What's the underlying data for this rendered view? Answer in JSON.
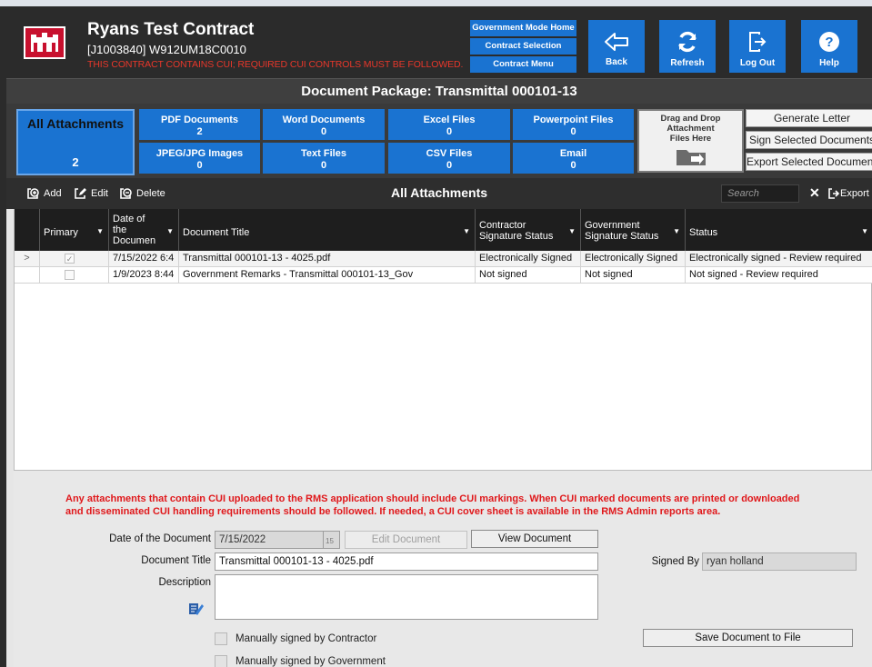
{
  "header": {
    "title": "Ryans Test Contract",
    "contract_id": "[J1003840] W912UM18C0010",
    "cui_warning": "THIS CONTRACT CONTAINS CUI; REQUIRED CUI CONTROLS MUST BE FOLLOWED.",
    "nav": {
      "gov_mode_home": "Government Mode Home",
      "contract_selection": "Contract Selection",
      "contract_menu": "Contract Menu"
    },
    "buttons": {
      "back": "Back",
      "refresh": "Refresh",
      "logout": "Log Out",
      "help": "Help"
    }
  },
  "package_title": "Document Package: Transmittal 000101-13",
  "categories": {
    "all": {
      "label": "All Attachments",
      "count": "2"
    },
    "pdf": {
      "label": "PDF Documents",
      "count": "2"
    },
    "word": {
      "label": "Word Documents",
      "count": "0"
    },
    "excel": {
      "label": "Excel Files",
      "count": "0"
    },
    "ppt": {
      "label": "Powerpoint Files",
      "count": "0"
    },
    "jpeg": {
      "label": "JPEG/JPG Images",
      "count": "0"
    },
    "text": {
      "label": "Text Files",
      "count": "0"
    },
    "csv": {
      "label": "CSV Files",
      "count": "0"
    },
    "email": {
      "label": "Email",
      "count": "0"
    }
  },
  "dropzone": {
    "line1": "Drag and Drop",
    "line2": "Attachment",
    "line3": "Files Here"
  },
  "actions": {
    "generate_letter": "Generate Letter",
    "sign_selected": "Sign Selected Documents",
    "export_selected": "Export Selected Documents"
  },
  "toolbar": {
    "add": "Add",
    "edit": "Edit",
    "delete": "Delete",
    "title": "All Attachments",
    "search_placeholder": "Search",
    "export": "Export"
  },
  "grid": {
    "headers": {
      "primary": "Primary",
      "date_1": "Date of",
      "date_2": "the",
      "date_3": "Documen",
      "title": "Document Title",
      "contractor_1": "Contractor",
      "contractor_2": "Signature Status",
      "government_1": "Government",
      "government_2": "Signature Status",
      "status": "Status"
    },
    "rows": [
      {
        "indicator": ">",
        "primary": true,
        "date": "7/15/2022 6:4",
        "title": "Transmittal 000101-13 - 4025.pdf",
        "contractor": "Electronically Signed",
        "government": "Electronically Signed",
        "status": "Electronically signed - Review required"
      },
      {
        "indicator": "",
        "primary": false,
        "date": "1/9/2023 8:44",
        "title": "Government Remarks - Transmittal 000101-13_Gov",
        "contractor": "Not signed",
        "government": "Not signed",
        "status": "Not signed - Review required"
      }
    ]
  },
  "details": {
    "notice_line1": "Any attachments that contain CUI uploaded to the RMS application should include CUI markings. When CUI marked documents are printed or downloaded",
    "notice_line2": "and disseminated CUI handling requirements should be followed. If needed, a CUI cover sheet is available in the RMS Admin reports area.",
    "date_label": "Date of the Document",
    "date_value": "7/15/2022",
    "calendar_day": "15",
    "edit_document": "Edit Document",
    "view_document": "View Document",
    "title_label": "Document Title",
    "title_value": "Transmittal 000101-13 - 4025.pdf",
    "description_label": "Description",
    "signed_by_label": "Signed By",
    "signed_by_value": "ryan holland",
    "manual_contractor": "Manually signed by Contractor",
    "manual_government": "Manually signed by Government",
    "save_to_file": "Save Document to File"
  },
  "colors": {
    "accent_blue": "#1a73d1",
    "header_dark": "#2b2b2b",
    "warning_red": "#e0181b"
  }
}
